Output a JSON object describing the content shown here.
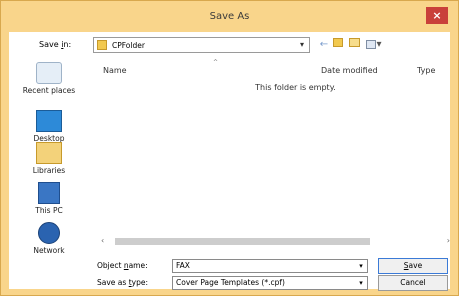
{
  "window": {
    "title": "Save As",
    "close_glyph": "×"
  },
  "toolbar": {
    "save_in_label_pre": "Save ",
    "save_in_label_u": "i",
    "save_in_label_post": "n:",
    "save_in_value": "CPFolder",
    "icons": [
      "back-icon",
      "up-folder-icon",
      "new-folder-icon",
      "view-menu-icon"
    ]
  },
  "places": [
    {
      "label": "Recent places",
      "icon": "recent-places-icon"
    },
    {
      "label": "Desktop",
      "icon": "desktop-icon"
    },
    {
      "label": "Libraries",
      "icon": "libraries-icon"
    },
    {
      "label": "This PC",
      "icon": "this-pc-icon"
    },
    {
      "label": "Network",
      "icon": "network-icon"
    }
  ],
  "filelist": {
    "columns": [
      "Name",
      "Date modified",
      "Type"
    ],
    "empty_message": "This folder is empty."
  },
  "fields": {
    "object_name_label_pre": "Object ",
    "object_name_label_u": "n",
    "object_name_label_post": "ame:",
    "object_name_value": "FAX",
    "save_as_type_label_pre": "Save as ",
    "save_as_type_label_u": "t",
    "save_as_type_label_post": "ype:",
    "save_as_type_value": "Cover Page Templates (*.cpf)"
  },
  "buttons": {
    "save_u": "S",
    "save_rest": "ave",
    "cancel": "Cancel"
  },
  "colors": {
    "titlebar": "#f9d58b",
    "close": "#c9403a"
  }
}
